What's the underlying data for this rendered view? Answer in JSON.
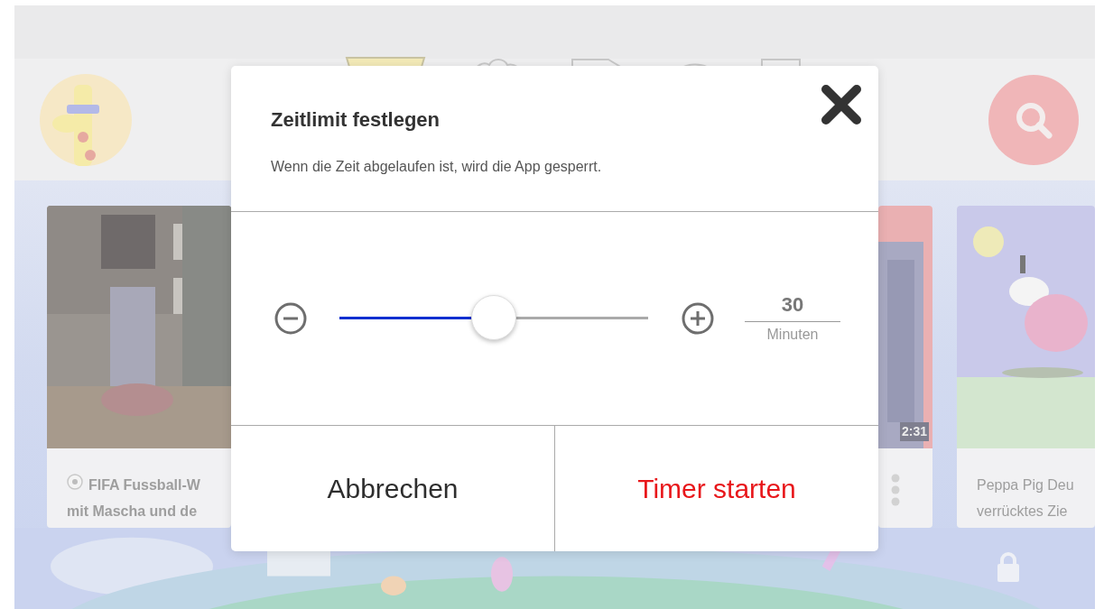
{
  "background": {
    "video_cards": [
      {
        "kind": "title",
        "title_lines": [
          "FIFA Fussball-W",
          "mit Mascha und de"
        ]
      },
      {
        "kind": "duration",
        "duration": "2:31"
      },
      {
        "kind": "title",
        "title_lines": [
          "Peppa Pig Deu",
          "verrücktes Zie"
        ]
      }
    ]
  },
  "dialog": {
    "title": "Zeitlimit festlegen",
    "message": "Wenn die Zeit abgelaufen ist, wird die App gesperrt.",
    "slider": {
      "level": 0.5
    },
    "value": "30",
    "unit": "Minuten",
    "buttons": [
      {
        "label": "Abbrechen",
        "kind": "cancel"
      },
      {
        "label": "Timer starten",
        "kind": "confirm"
      }
    ]
  }
}
